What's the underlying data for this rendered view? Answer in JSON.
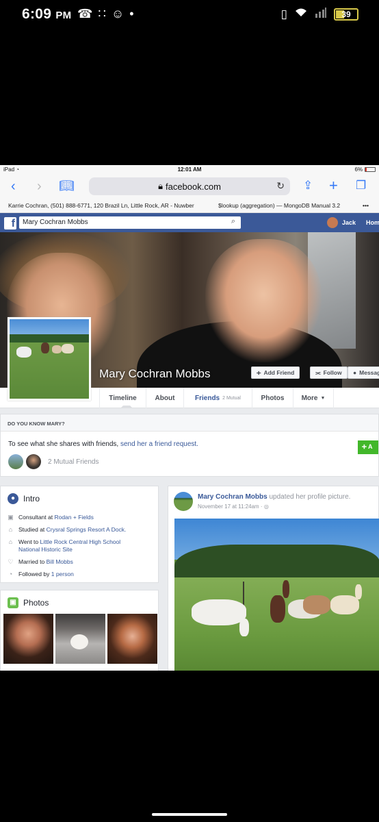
{
  "android_status": {
    "time": "6:09",
    "ampm": "PM",
    "battery": "39",
    "left_icons": [
      "missed-call-icon",
      "voicemail-icon",
      "add-user-icon",
      "dot-icon"
    ],
    "right_icons": [
      "vibrate-icon",
      "wifi-icon",
      "signal-icon",
      "battery-icon"
    ]
  },
  "ipad_status": {
    "device": "iPad",
    "time": "12:01 AM",
    "battery_pct": "6%"
  },
  "safari": {
    "url": "facebook.com",
    "bookmarks": [
      "Karrie Cochran, (501) 888-6771, 120 Brazil Ln, Little Rock, AR - Nuwber",
      "$lookup (aggregation) — MongoDB Manual 3.2"
    ],
    "more": "•••"
  },
  "fb_header": {
    "logo": "f",
    "search_value": "Mary Cochran Mobbs",
    "user_name": "Jack",
    "home": "Home"
  },
  "profile": {
    "name": "Mary Cochran Mobbs",
    "add_friend": "Add Friend",
    "follow": "Follow",
    "message": "Message"
  },
  "tabs": {
    "timeline": "Timeline",
    "about": "About",
    "friends": "Friends",
    "friends_sub": "2 Mutual",
    "photos": "Photos",
    "more": "More"
  },
  "know": {
    "header": "DO YOU KNOW MARY?",
    "text": "To see what she shares with friends,",
    "link": "send her a friend request.",
    "mutual": "2 Mutual Friends",
    "add": "A"
  },
  "intro": {
    "title": "Intro",
    "rows": [
      {
        "icon": "briefcase-icon",
        "prefix": "Consultant at",
        "link": "Rodan + Fields"
      },
      {
        "icon": "graduation-cap-icon",
        "prefix": "Studied at",
        "link": "Crysral Springs Resort A Dock."
      },
      {
        "icon": "graduation-cap-icon",
        "prefix": "Went to",
        "link": "Little Rock Central High School",
        "link2": "National Historic Site"
      },
      {
        "icon": "heart-icon",
        "prefix": "Married to",
        "link": "Bill Mobbs"
      },
      {
        "icon": "rss-icon",
        "prefix": "Followed by",
        "link": "1 person"
      }
    ]
  },
  "photos": {
    "title": "Photos"
  },
  "post": {
    "author": "Mary Cochran Mobbs",
    "action": "updated her profile picture.",
    "date": "November 17 at 11:24am",
    "dot": "·"
  },
  "colors": {
    "facebook_blue": "#3b5998",
    "link_blue": "#385898",
    "green_button": "#42b72a",
    "background_gray": "#e9ebee"
  }
}
